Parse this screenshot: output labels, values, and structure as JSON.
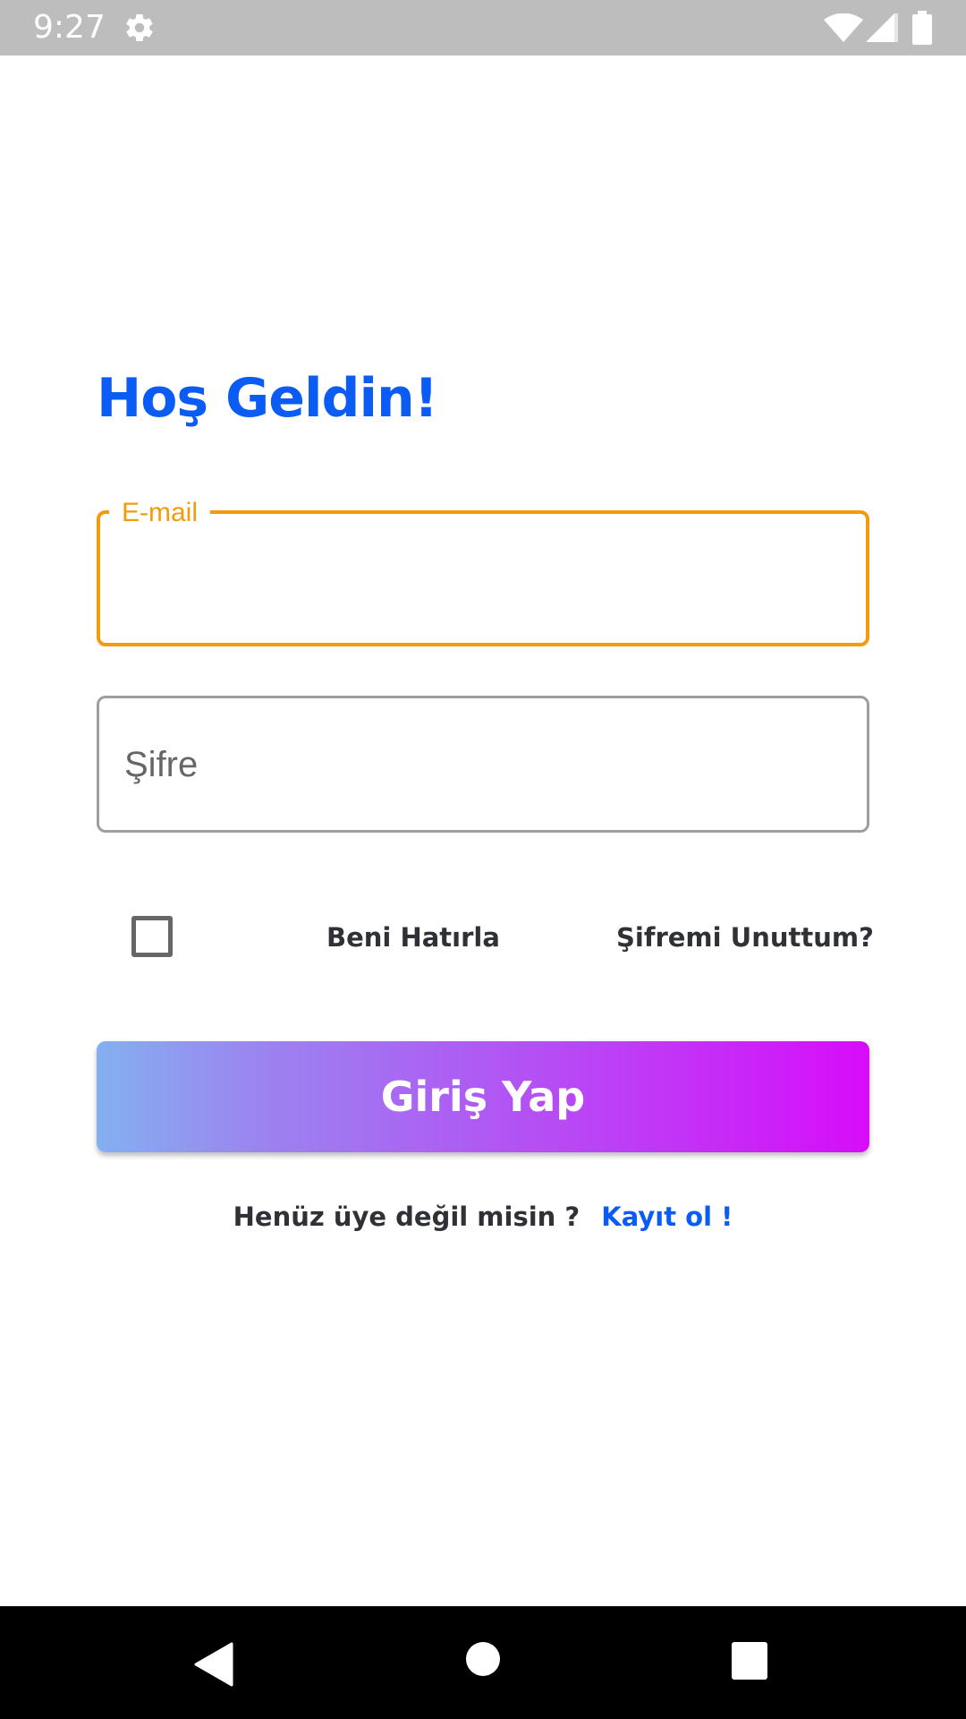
{
  "status_bar": {
    "time": "9:27",
    "icons": [
      "gear-icon",
      "wifi-icon",
      "signal-icon",
      "battery-icon"
    ]
  },
  "login": {
    "title": "Hoş Geldin!",
    "email_label": "E-mail",
    "email_value": "",
    "password_placeholder": "Şifre",
    "password_value": "",
    "remember_me_label": "Beni Hatırla",
    "remember_me_checked": false,
    "forgot_password_label": "Şifremi Unuttum?",
    "login_button_label": "Giriş Yap",
    "signup_prompt": "Henüz üye değil misin ?",
    "signup_link": "Kayıt ol !"
  },
  "navigation_bar": {
    "buttons": [
      "back-icon",
      "home-icon",
      "recents-icon"
    ]
  },
  "colors": {
    "title_blue": "#0a5cf5",
    "focus_orange": "#f49b0b",
    "button_gradient_start": "#84b0f0",
    "button_gradient_end": "#d70cfa",
    "status_bar": "#bdbdbd",
    "nav_bar": "#000000"
  }
}
